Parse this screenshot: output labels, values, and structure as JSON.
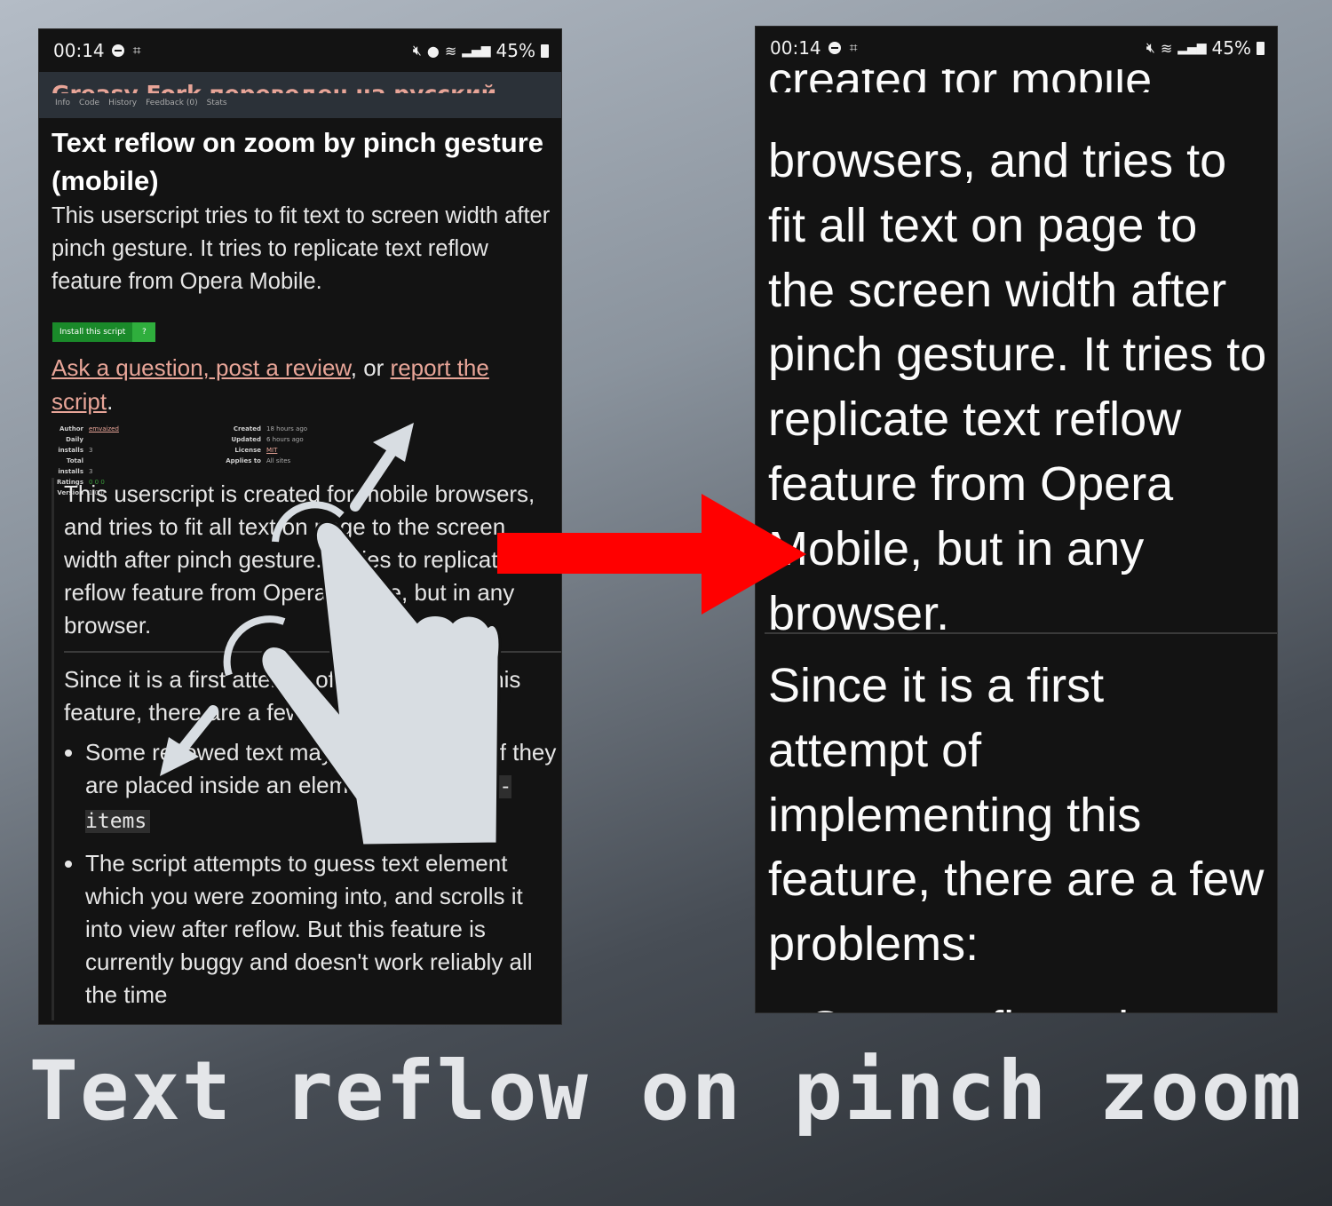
{
  "status_bar": {
    "time": "00:14",
    "battery": "45%"
  },
  "left_phone": {
    "cut_header": "Greasy Fork переведен на русский.",
    "tabs": [
      "Info",
      "Code",
      "History",
      "Feedback (0)",
      "Stats"
    ],
    "title": "Text reflow on zoom by pinch gesture (mobile)",
    "description": "This userscript tries to fit text to screen width after pinch gesture. It tries to replicate text reflow feature from Opera Mobile.",
    "install_button": "Install this script",
    "install_help": "?",
    "ask": {
      "link1": "Ask a question, post a review",
      "mid": ", or ",
      "link2": "report the script",
      "end": "."
    },
    "meta_left": [
      {
        "k": "Author",
        "v": "emvaized"
      },
      {
        "k": "Daily installs",
        "v": "3"
      },
      {
        "k": "Total installs",
        "v": "3"
      },
      {
        "k": "Ratings",
        "v": "0 0 0"
      },
      {
        "k": "Version",
        "v": "1.0.0"
      }
    ],
    "meta_right": [
      {
        "k": "Created",
        "v": "18 hours ago"
      },
      {
        "k": "Updated",
        "v": "6 hours ago"
      },
      {
        "k": "License",
        "v": "MIT"
      },
      {
        "k": "Applies to",
        "v": "All sites"
      }
    ],
    "para1": "This userscript is created for mobile browsers, and tries to fit all text on page to the screen width after pinch gesture. It tries to replicate text reflow feature from Opera Mobile, but in any browser.",
    "para2": "Since it is a first attempt of implementing this feature, there are a few problems:",
    "bullet1_pre": "Some reflowed text may be misaligned, if they are placed inside an element with",
    "bullet1_code": "align-items",
    "bullet2": "The script attempts to guess text element which you were zooming into, and scrolls it into view after reflow. But this feature is currently buggy and doesn't work reliably all the time"
  },
  "right_phone": {
    "cut_top": "created for mobile",
    "para1": "browsers, and tries to fit all text on page to the screen width after pinch gesture. It tries to replicate text reflow feature from Opera Mobile, but in any browser.",
    "para2": "Since it is a first attempt of implementing this feature, there are a few problems:",
    "cut_bottom": "Some reflowed text"
  },
  "caption": "Text reflow on pinch zoom",
  "colors": {
    "arrow": "#ff0000",
    "hand": "#d8dde2",
    "link": "#e8a598",
    "install": "#1a8a2a"
  },
  "icons": [
    "do-not-disturb-icon",
    "screenshot-icon",
    "mute-icon",
    "location-icon",
    "wifi-icon",
    "signal-icon",
    "battery-icon",
    "pinch-hand-icon",
    "expand-arrow-icon",
    "red-arrow-icon"
  ]
}
